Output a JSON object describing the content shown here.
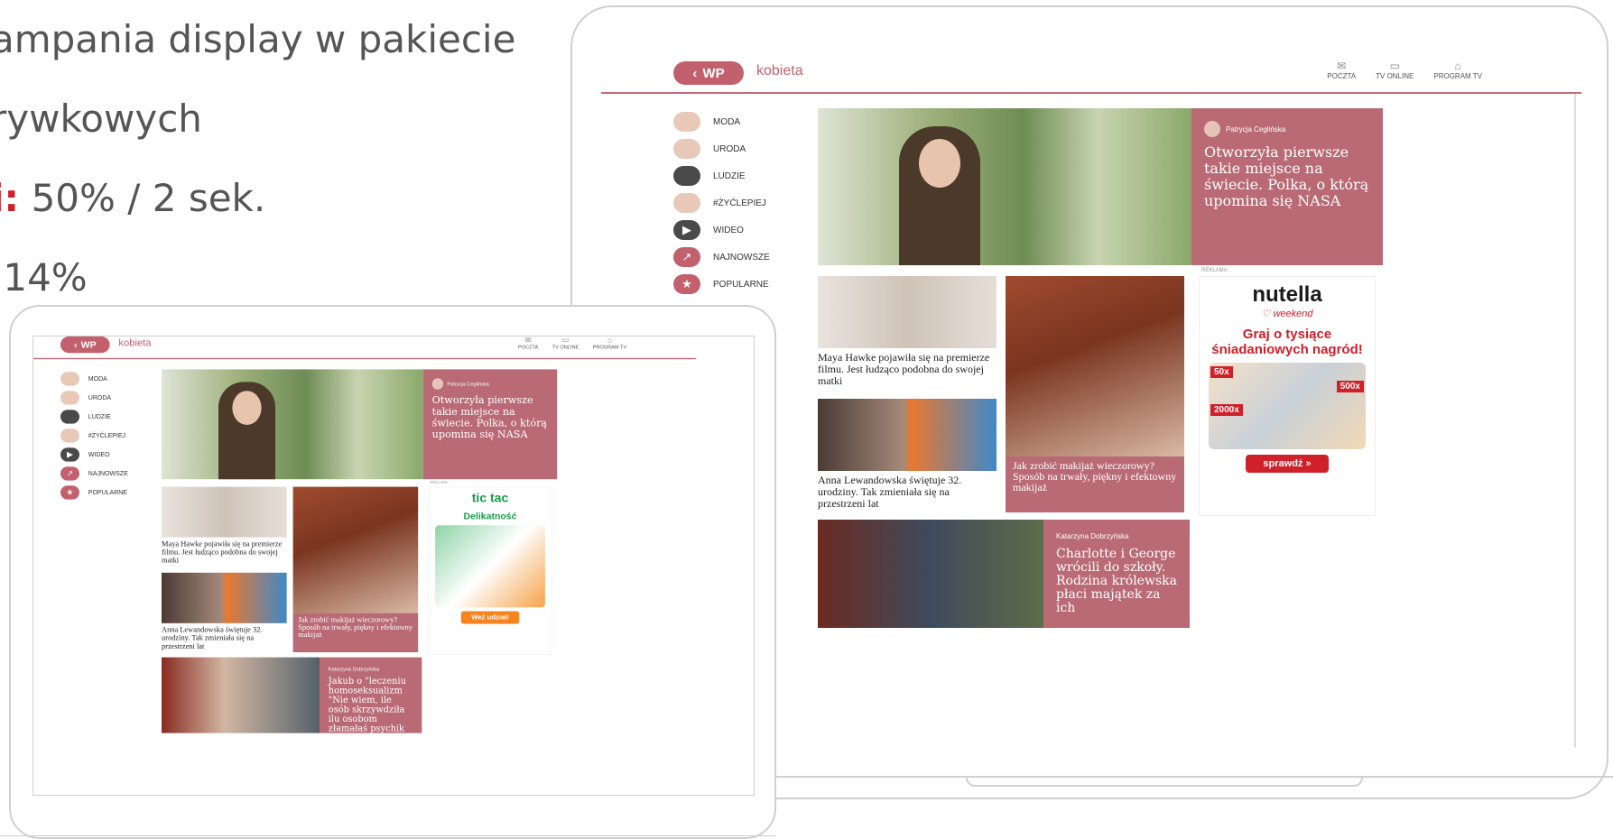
{
  "slide": {
    "bullet1": "ampania display w pakiecie",
    "bullet2": "rywkowych",
    "bullet3_accent": "i:",
    "bullet3_rest": "50% / 2 sek.",
    "bullet4": ",14%"
  },
  "site": {
    "logo_back": "‹",
    "logo_text": "WP",
    "brand": "kobieta",
    "topnav": [
      {
        "label": "POCZTA",
        "icon": "mail-icon"
      },
      {
        "label": "TV ONLINE",
        "icon": "tv-icon"
      },
      {
        "label": "PROGRAM TV",
        "icon": "tv-guide-icon"
      }
    ],
    "sidebar": [
      "MODA",
      "URODA",
      "LUDZIE",
      "#ŻYĆLEPIEJ",
      "WIDEO",
      "NAJNOWSZE",
      "POPULARNE"
    ],
    "hero": {
      "author": "Patrycja Ceglińska",
      "title": "Otworzyła pierwsze takie miejsce na świecie. Polka, o którą upomina się NASA"
    },
    "card1": "Maya Hawke pojawiła się na premierze filmu. Jest łudząco podobna do swojej matki",
    "card2": "Anna Lewandowska świętuje 32. urodziny. Tak zmieniała się na przestrzeni lat",
    "tall": "Jak zrobić makijaż wieczorowy? Sposób na trwały, piękny i efektowny makijaż",
    "big_ad": {
      "label": "REKLAMA",
      "brand": "nutella",
      "sub": "weekend",
      "headline": "Graj o tysiące śniadaniowych nagród!",
      "tags": [
        "50x",
        "500x",
        "2000x"
      ],
      "cta": "sprawdź »"
    },
    "small_ad": {
      "label": "REKLAMA",
      "brand": "tic tac",
      "headline": "Delikatność",
      "cta": "Weź udział!"
    },
    "story_big": {
      "author": "Katarzyna Dobrzyńska",
      "title": "Charlotte i George wrócili do szkoły. Rodzina królewska płaci majątek za ich"
    },
    "story_small": {
      "author": "Katarzyna Dobrzyńska",
      "title": "Jakub o \"leczeniu homoseksualizm \"Nie wiem, ile osób skrzywdziła ilu osobom złamałaś psychik"
    }
  }
}
